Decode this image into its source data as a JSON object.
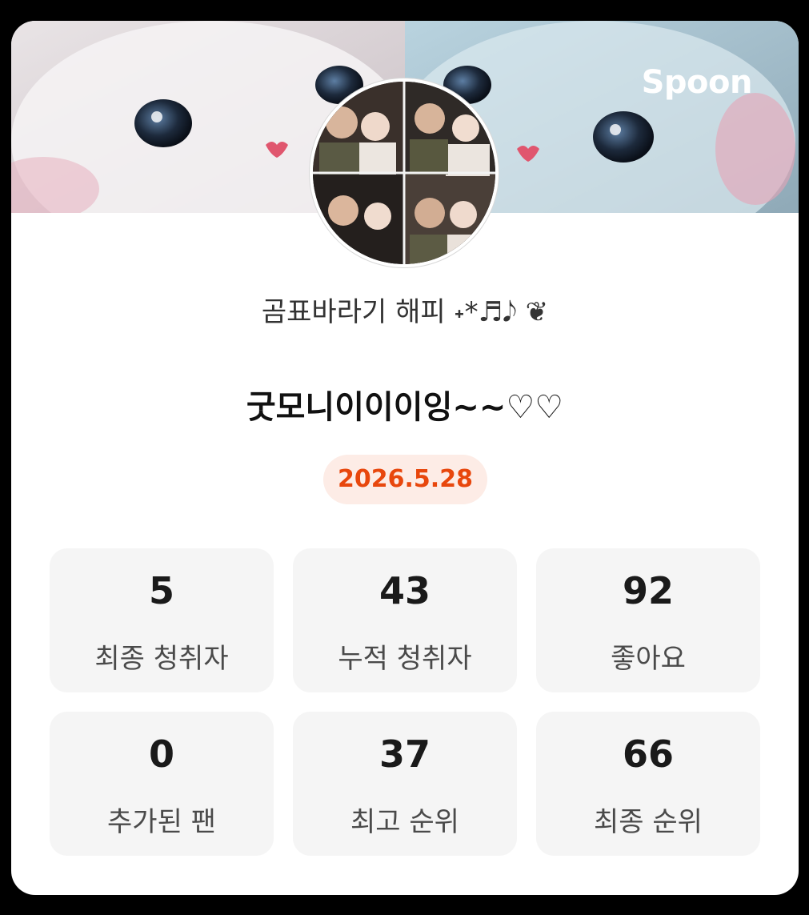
{
  "brand": {
    "label": "Spoon"
  },
  "profile": {
    "nickname": "곰표바라기 해피 ˖*♬𝅘𝅥𝅮 ❦",
    "title": "굿모니이이이잉~~♡♡",
    "date": "2026.5.28"
  },
  "stats": [
    {
      "value": "5",
      "label": "최종 청취자"
    },
    {
      "value": "43",
      "label": "누적 청취자"
    },
    {
      "value": "92",
      "label": "좋아요"
    },
    {
      "value": "0",
      "label": "추가된 팬"
    },
    {
      "value": "37",
      "label": "최고 순위"
    },
    {
      "value": "66",
      "label": "최종 순위"
    }
  ],
  "colors": {
    "accent": "#e8470d",
    "badge_bg": "#fdece6",
    "stat_bg": "#f5f5f5"
  }
}
